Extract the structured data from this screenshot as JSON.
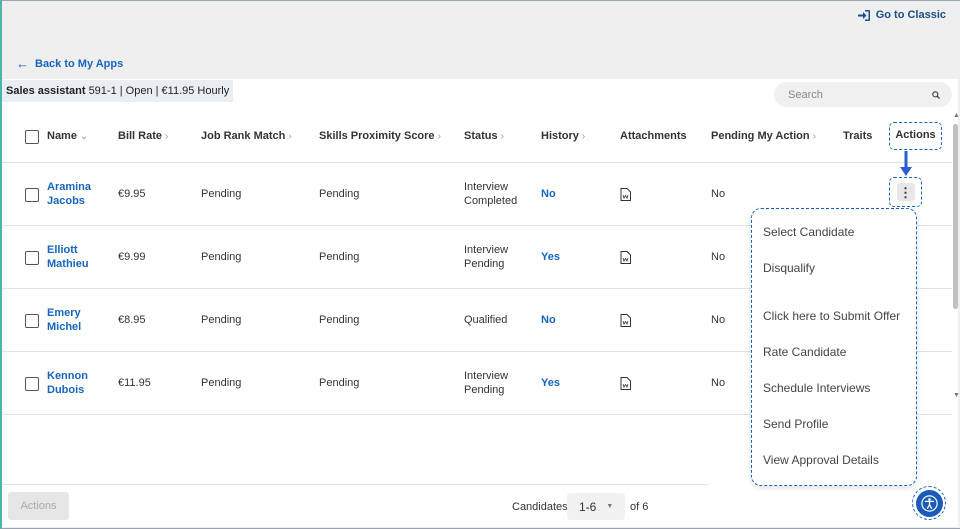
{
  "top": {
    "go_classic": "Go to Classic",
    "back_link": "Back to My Apps"
  },
  "job": {
    "title": "Sales assistant",
    "details": "591-1 | Open | €11.95 Hourly"
  },
  "search": {
    "placeholder": "Search"
  },
  "table": {
    "headers": {
      "name": "Name",
      "bill_rate": "Bill Rate",
      "job_rank_match": "Job Rank Match",
      "skills_proximity": "Skills Proximity Score",
      "status": "Status",
      "history": "History",
      "attachments": "Attachments",
      "pending_my_action": "Pending My Action",
      "traits": "Traits",
      "actions": "Actions"
    },
    "rows": [
      {
        "first": "Aramina",
        "last": "Jacobs",
        "bill_rate": "€9.95",
        "job_rank": "Pending",
        "skills": "Pending",
        "status_1": "Interview",
        "status_2": "Completed",
        "history": "No",
        "pending": "No"
      },
      {
        "first": "Elliott",
        "last": "Mathieu",
        "bill_rate": "€9.99",
        "job_rank": "Pending",
        "skills": "Pending",
        "status_1": "Interview",
        "status_2": "Pending",
        "history": "Yes",
        "pending": "No"
      },
      {
        "first": "Emery",
        "last": "Michel",
        "bill_rate": "€8.95",
        "job_rank": "Pending",
        "skills": "Pending",
        "status_1": "Qualified",
        "status_2": "",
        "history": "No",
        "pending": "No"
      },
      {
        "first": "Kennon",
        "last": "Dubois",
        "bill_rate": "€11.95",
        "job_rank": "Pending",
        "skills": "Pending",
        "status_1": "Interview",
        "status_2": "Pending",
        "history": "Yes",
        "pending": "No"
      }
    ]
  },
  "menu": {
    "items": [
      "Select Candidate",
      "Disqualify",
      "Click here to Submit Offer",
      "Rate Candidate",
      "Schedule Interviews",
      "Send Profile",
      "View Approval Details"
    ]
  },
  "footer": {
    "actions": "Actions",
    "candidates_label": "Candidates",
    "page_range": "1-6",
    "of_total": "of 6"
  },
  "colors": {
    "link": "#1565c0",
    "highlight_dash": "#1565c0",
    "accessibility": "#1a5bb8"
  },
  "icons": [
    "sign-in-icon",
    "arrow-left-icon",
    "search-icon",
    "document-icon",
    "kebab-menu-icon",
    "arrow-down-icon",
    "accessibility-icon"
  ]
}
